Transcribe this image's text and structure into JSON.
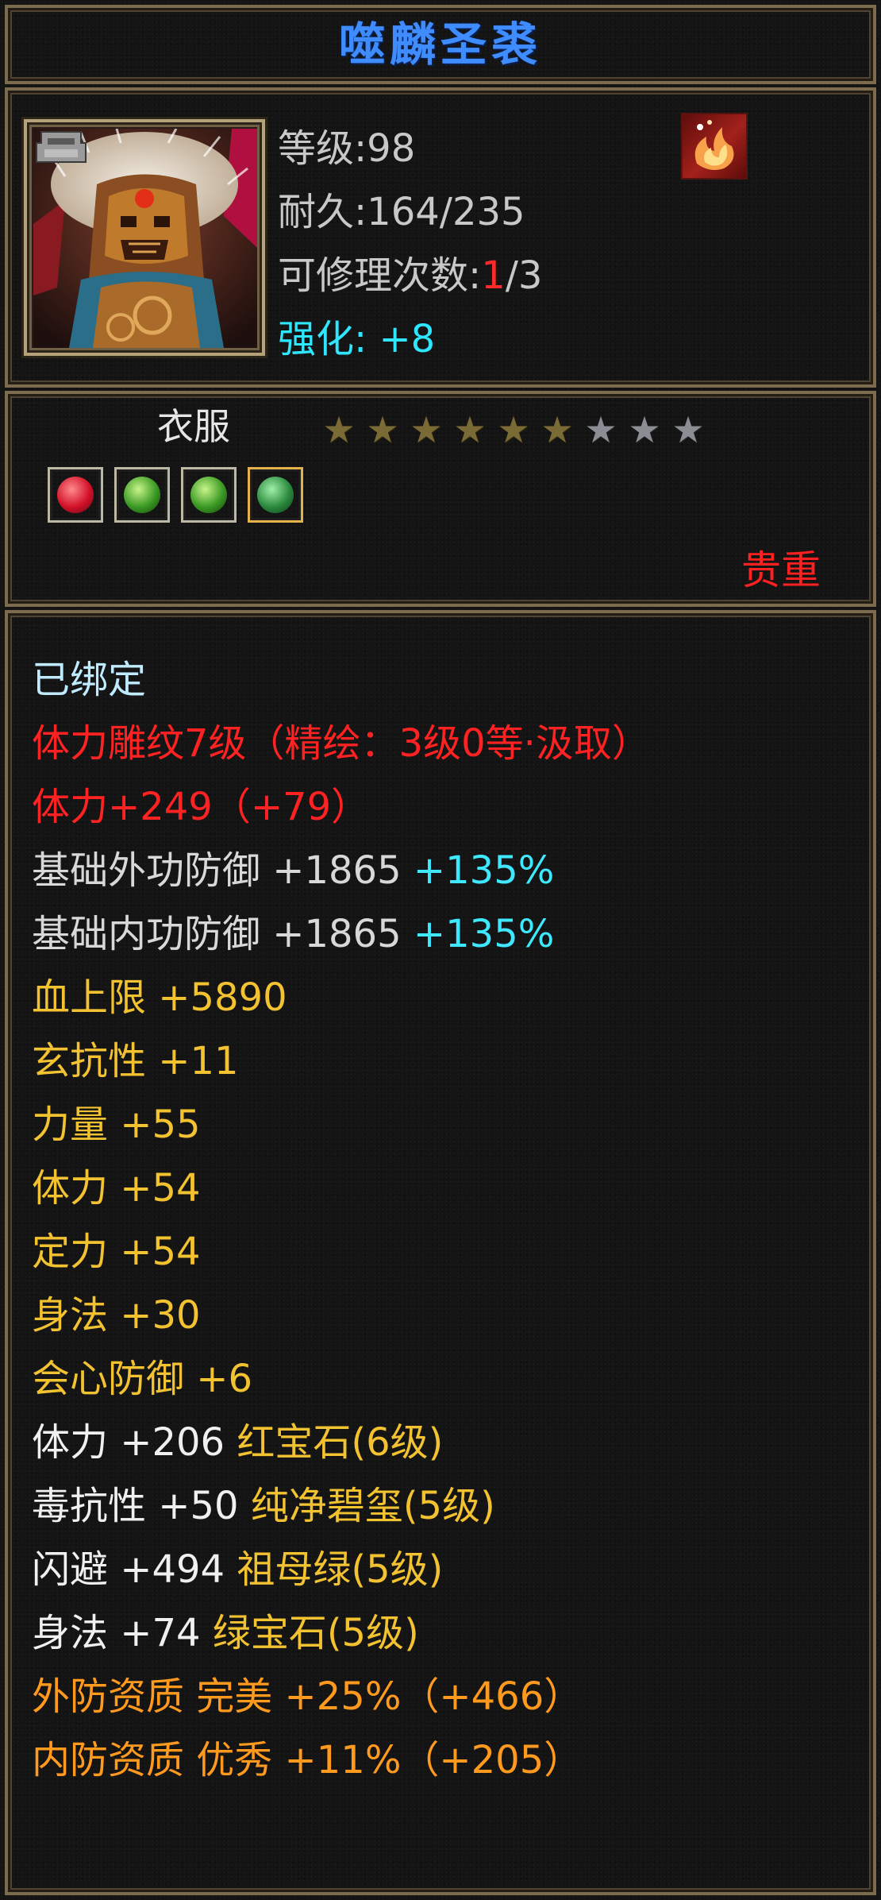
{
  "item": {
    "name": "噬麟圣裘",
    "level_text": "等级:98",
    "durability_text": "耐久:164/235",
    "repair_label": "可修理次数:",
    "repair_used": "1",
    "repair_total": "/3",
    "enhance_label": "强化:",
    "enhance_value": "+8",
    "type": "衣服",
    "stars_total": 9,
    "stars_filled": 6,
    "gem_slots": [
      "red-gem-icon",
      "green-gem-icon",
      "green-gem-icon",
      "jade-gem-icon"
    ],
    "rarity": "贵重"
  },
  "attributes": [
    {
      "segments": [
        {
          "text": "已绑定",
          "color": "cyan-lt"
        }
      ]
    },
    {
      "segments": [
        {
          "text": "体力雕纹7级（精绘：3级0等·汲取）",
          "color": "red"
        }
      ]
    },
    {
      "segments": [
        {
          "text": "体力+249（+79）",
          "color": "red"
        }
      ]
    },
    {
      "segments": [
        {
          "text": "基础外功防御 +1865 ",
          "color": "grey"
        },
        {
          "text": "+135%",
          "color": "cyan"
        }
      ]
    },
    {
      "segments": [
        {
          "text": "基础内功防御 +1865 ",
          "color": "grey"
        },
        {
          "text": "+135%",
          "color": "cyan"
        }
      ]
    },
    {
      "segments": [
        {
          "text": "血上限 +5890",
          "color": "yellow"
        }
      ]
    },
    {
      "segments": [
        {
          "text": "玄抗性 +11",
          "color": "yellow"
        }
      ]
    },
    {
      "segments": [
        {
          "text": "力量 +55",
          "color": "yellow"
        }
      ]
    },
    {
      "segments": [
        {
          "text": "体力 +54",
          "color": "yellow"
        }
      ]
    },
    {
      "segments": [
        {
          "text": "定力 +54",
          "color": "yellow"
        }
      ]
    },
    {
      "segments": [
        {
          "text": "身法 +30",
          "color": "yellow"
        }
      ]
    },
    {
      "segments": [
        {
          "text": "会心防御 +6",
          "color": "yellow"
        }
      ]
    },
    {
      "segments": [
        {
          "text": "体力 +206 ",
          "color": "white"
        },
        {
          "text": "红宝石(6级)",
          "color": "yellow"
        }
      ]
    },
    {
      "segments": [
        {
          "text": "毒抗性 +50 ",
          "color": "white"
        },
        {
          "text": "纯净碧玺(5级)",
          "color": "yellow"
        }
      ]
    },
    {
      "segments": [
        {
          "text": "闪避 +494 ",
          "color": "white"
        },
        {
          "text": "祖母绿(5级)",
          "color": "yellow"
        }
      ]
    },
    {
      "segments": [
        {
          "text": "身法 +74 ",
          "color": "white"
        },
        {
          "text": "绿宝石(5级)",
          "color": "yellow"
        }
      ]
    },
    {
      "segments": [
        {
          "text": "外防资质  完美 +25%（+466）",
          "color": "orange"
        }
      ]
    },
    {
      "segments": [
        {
          "text": "内防资质  优秀 +11%（+205）",
          "color": "orange"
        }
      ]
    }
  ]
}
